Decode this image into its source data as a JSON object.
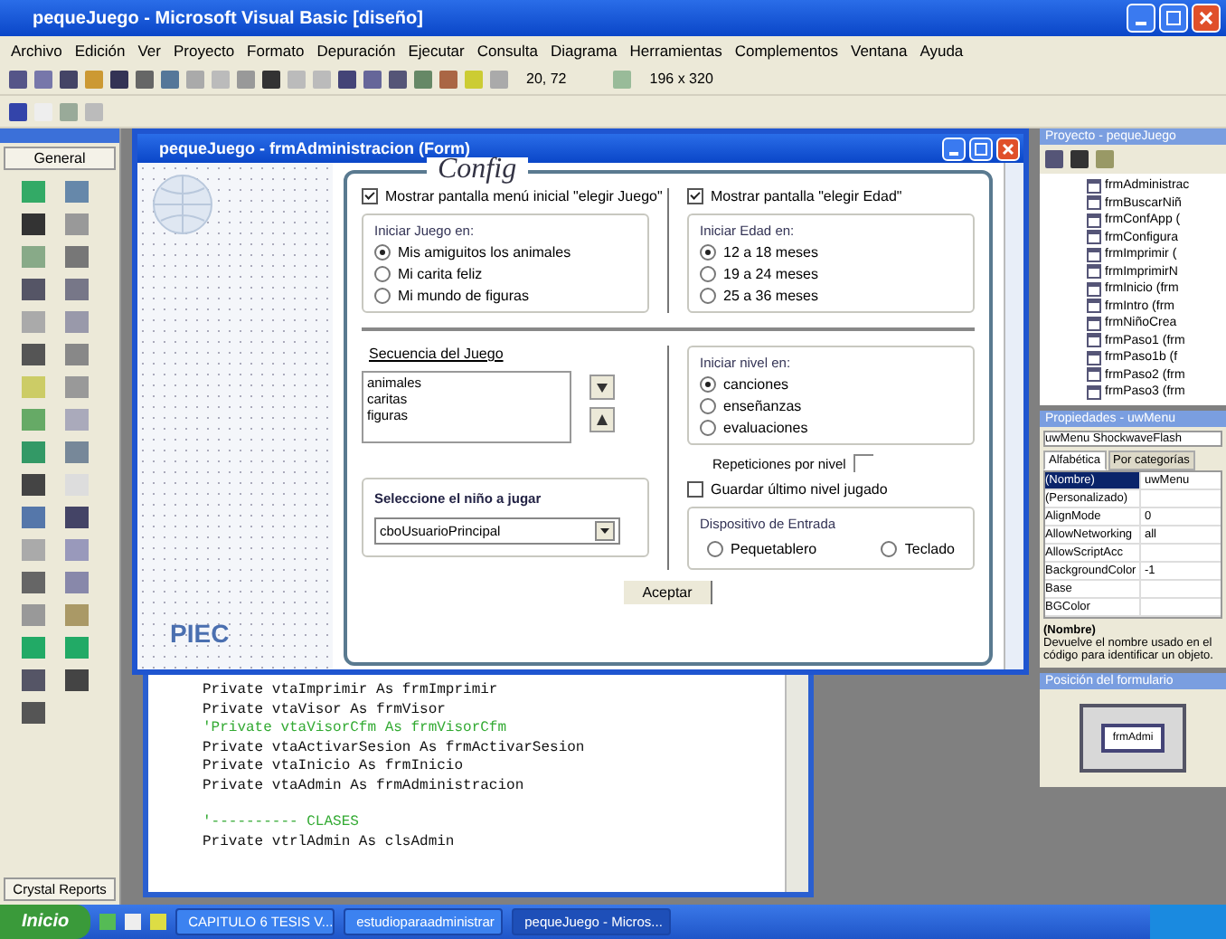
{
  "window": {
    "title": "pequeJuego - Microsoft Visual Basic [diseño]"
  },
  "menu": [
    "Archivo",
    "Edición",
    "Ver",
    "Proyecto",
    "Formato",
    "Depuración",
    "Ejecutar",
    "Consulta",
    "Diagrama",
    "Herramientas",
    "Complementos",
    "Ventana",
    "Ayuda"
  ],
  "toolbar": {
    "position": "20, 72",
    "size": "196 x 320"
  },
  "toolbox": {
    "tab": "General",
    "footer": "Crystal Reports"
  },
  "form_window": {
    "title": "pequeJuego - frmAdministracion (Form)",
    "logo": "PIEC",
    "frame_title": "Config",
    "checkboxes": [
      {
        "label": "Mostrar pantalla menú inicial \"elegir Juego\"",
        "checked": true
      },
      {
        "label": "Mostrar pantalla \"elegir Edad\"",
        "checked": true
      }
    ],
    "groups": [
      {
        "title": "Iniciar Juego en:",
        "options": [
          {
            "label": "Mis amiguitos los animales",
            "selected": true
          },
          {
            "label": "Mi carita feliz",
            "selected": false
          },
          {
            "label": "Mi mundo de figuras",
            "selected": false
          }
        ]
      },
      {
        "title": "Iniciar Edad en:",
        "options": [
          {
            "label": "12 a 18 meses",
            "selected": true
          },
          {
            "label": "19 a 24 meses",
            "selected": false
          },
          {
            "label": "25 a 36 meses",
            "selected": false
          }
        ]
      }
    ],
    "sequence": {
      "label": "Secuencia del Juego",
      "items": [
        "animales",
        "caritas",
        "figuras"
      ]
    },
    "child_select": {
      "title": "Seleccione el niño a jugar",
      "value": "cboUsuarioPrincipal"
    },
    "level_group": {
      "title": "Iniciar nivel en:",
      "options": [
        {
          "label": "canciones",
          "selected": true
        },
        {
          "label": "enseñanzas",
          "selected": false
        },
        {
          "label": "evaluaciones",
          "selected": false
        }
      ]
    },
    "repetitions": {
      "label": "Repeticiones por nivel"
    },
    "save_level": {
      "label": "Guardar último nivel jugado",
      "checked": false
    },
    "input_device": {
      "title": "Dispositivo de Entrada",
      "options": [
        {
          "label": "Pequetablero",
          "selected": false
        },
        {
          "label": "Teclado",
          "selected": false
        }
      ]
    },
    "accept_button": "Aceptar"
  },
  "code_window": {
    "lines": [
      {
        "kind": "code",
        "text": "Private vtaImprimir As frmImprimir"
      },
      {
        "kind": "code",
        "text": "Private vtaVisor As frmVisor"
      },
      {
        "kind": "comment",
        "text": "'Private vtaVisorCfm As frmVisorCfm"
      },
      {
        "kind": "code",
        "text": "Private vtaActivarSesion As frmActivarSesion"
      },
      {
        "kind": "code",
        "text": "Private vtaInicio As frmInicio"
      },
      {
        "kind": "code",
        "text": "Private vtaAdmin As frmAdministracion"
      },
      {
        "kind": "comment",
        "text": "'---------- CLASES"
      },
      {
        "kind": "code",
        "text": "Private vtrlAdmin As clsAdmin"
      }
    ]
  },
  "project": {
    "title": "Proyecto - pequeJuego",
    "items": [
      "frmAdministrac",
      "frmBuscarNiñ",
      "frmConfApp (",
      "frmConfigura",
      "frmImprimir (",
      "frmImprimirN",
      "frmInicio (frm",
      "frmIntro (frm",
      "frmNiñoCrea",
      "frmPaso1 (frm",
      "frmPaso1b (f",
      "frmPaso2 (frm",
      "frmPaso3 (frm"
    ]
  },
  "properties": {
    "title": "Propiedades - uwMenu",
    "object": "uwMenu ShockwaveFlash",
    "tabs": [
      {
        "label": "Alfabética",
        "selected": true
      },
      {
        "label": "Por categorías",
        "selected": false
      }
    ],
    "rows": [
      {
        "name": "(Nombre)",
        "value": "uwMenu",
        "selected": true
      },
      {
        "name": "(Personalizado)",
        "selected": false
      },
      {
        "name": "AlignMode",
        "value": "0",
        "selected": false
      },
      {
        "name": "AllowNetworking",
        "value": "all",
        "selected": false
      },
      {
        "name": "AllowScriptAcc",
        "selected": false
      },
      {
        "name": "BackgroundColor",
        "value": "-1",
        "selected": false
      },
      {
        "name": "Base",
        "selected": false
      },
      {
        "name": "BGColor",
        "selected": false
      }
    ],
    "description_title": "(Nombre)",
    "description": "Devuelve el nombre usado en el código para identificar un objeto."
  },
  "form_layout": {
    "title": "Posición del formulario",
    "form": "frmAdmi"
  },
  "taskbar": {
    "start": "Inicio",
    "tasks": [
      {
        "label": "CAPITULO 6 TESIS V...",
        "selected": false
      },
      {
        "label": "estudioparaadministrar",
        "selected": false
      },
      {
        "label": "pequeJuego - Micros...",
        "selected": true
      }
    ]
  }
}
